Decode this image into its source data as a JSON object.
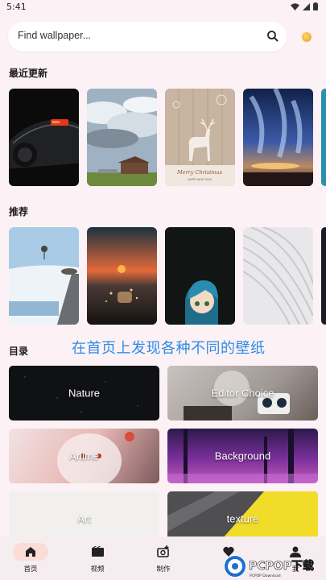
{
  "status": {
    "time": "5:41"
  },
  "search": {
    "placeholder": "Find wallpaper..."
  },
  "sections": {
    "recent": "最近更新",
    "recommended": "推荐",
    "catalog": "目录"
  },
  "overlay_caption": "在首页上发现各种不同的壁纸",
  "categories": [
    {
      "label": "Nature"
    },
    {
      "label": "Editor Choice"
    },
    {
      "label": "Anime"
    },
    {
      "label": "Background"
    },
    {
      "label": "Art"
    },
    {
      "label": "texture"
    }
  ],
  "recent_cards": [
    "car",
    "barn-under-clouds",
    "merry-christmas-deer",
    "aurora",
    "sea-partial"
  ],
  "recommended_cards": [
    "snowy-road",
    "sunset-jar",
    "anime-girl",
    "white-waves",
    "dark-partial"
  ],
  "christmas_text": {
    "line1": "Merry Christmas",
    "line2": "HAPPY NEW YEAR"
  },
  "nav": [
    {
      "label": "首页",
      "icon": "home-icon",
      "active": true
    },
    {
      "label": "视频",
      "icon": "video-icon"
    },
    {
      "label": "制作",
      "icon": "add-photo-icon"
    },
    {
      "label": "点",
      "icon": "heart-icon"
    },
    {
      "label": "我",
      "icon": "person-icon"
    }
  ],
  "watermark": {
    "brand": "PCPOP下载",
    "sub": "PCPOP Download"
  },
  "colors": {
    "accent": "#2f8be6",
    "active_pill": "#fcdcd6",
    "background": "#fcf2f5"
  }
}
